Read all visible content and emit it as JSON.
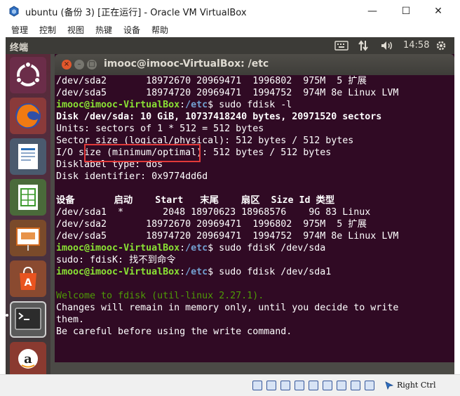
{
  "host": {
    "window_title": "ubuntu (备份 3) [正在运行] - Oracle VM VirtualBox",
    "menu": [
      "管理",
      "控制",
      "视图",
      "热键",
      "设备",
      "帮助"
    ],
    "controls": {
      "minimize": "—",
      "maximize": "☐",
      "close": "✕"
    },
    "host_key": "Right Ctrl"
  },
  "guest": {
    "panel_title": "终端",
    "clock": "14:58",
    "launcher_items": [
      "dash-home",
      "firefox",
      "libreoffice-writer",
      "libreoffice-calc",
      "libreoffice-impress",
      "ubuntu-software",
      "terminal",
      "amazon",
      "updater"
    ]
  },
  "terminal": {
    "title": "imooc@imooc-VirtualBox: /etc",
    "window_controls": {
      "close": "×",
      "minimize": "–",
      "maximize": "□"
    },
    "lines": [
      {
        "segments": [
          {
            "text": "/dev/sda2       18972670 20969471  1996802  975M  5 扩展",
            "style": "plain"
          }
        ]
      },
      {
        "segments": [
          {
            "text": "/dev/sda5       18974720 20969471  1994752  974M 8e Linux LVM",
            "style": "plain"
          }
        ]
      },
      {
        "segments": [
          {
            "text": "imooc@imooc-VirtualBox",
            "style": "prompt-user"
          },
          {
            "text": ":",
            "style": "plain"
          },
          {
            "text": "/etc",
            "style": "prompt-path"
          },
          {
            "text": "$ sudo fdisk -l",
            "style": "plain"
          }
        ]
      },
      {
        "segments": [
          {
            "text": "Disk /dev/sda: 10 GiB, 10737418240 bytes, 20971520 sectors",
            "style": "bold"
          }
        ]
      },
      {
        "segments": [
          {
            "text": "Units: sectors of 1 * 512 = 512 bytes",
            "style": "plain"
          }
        ]
      },
      {
        "segments": [
          {
            "text": "Sector size (logical/physical): 512 bytes / 512 bytes",
            "style": "plain"
          }
        ]
      },
      {
        "segments": [
          {
            "text": "I/O size (minimum/optimal): 512 bytes / 512 bytes",
            "style": "plain"
          }
        ]
      },
      {
        "segments": [
          {
            "text": "Disklabel type: dos",
            "style": "plain"
          }
        ]
      },
      {
        "segments": [
          {
            "text": "Disk identifier: 0x9774dd6d",
            "style": "plain"
          }
        ]
      },
      {
        "segments": [
          {
            "text": "",
            "style": "plain"
          }
        ]
      },
      {
        "segments": [
          {
            "text": "设备       启动    Start   末尾    扇区  Size Id 类型",
            "style": "bold"
          }
        ]
      },
      {
        "segments": [
          {
            "text": "/dev/sda1  *       2048 18970623 18968576    9G 83 Linux",
            "style": "plain"
          }
        ]
      },
      {
        "segments": [
          {
            "text": "/dev/sda2       18972670 20969471  1996802  975M  5 扩展",
            "style": "plain"
          }
        ]
      },
      {
        "segments": [
          {
            "text": "/dev/sda5       18974720 20969471  1994752  974M 8e Linux LVM",
            "style": "plain"
          }
        ]
      },
      {
        "segments": [
          {
            "text": "imooc@imooc-VirtualBox",
            "style": "prompt-user"
          },
          {
            "text": ":",
            "style": "plain"
          },
          {
            "text": "/etc",
            "style": "prompt-path"
          },
          {
            "text": "$ sudo fdisK /dev/sda",
            "style": "plain"
          }
        ]
      },
      {
        "segments": [
          {
            "text": "sudo: fdisK: 找不到命令",
            "style": "plain"
          }
        ]
      },
      {
        "segments": [
          {
            "text": "imooc@imooc-VirtualBox",
            "style": "prompt-user"
          },
          {
            "text": ":",
            "style": "plain"
          },
          {
            "text": "/etc",
            "style": "prompt-path"
          },
          {
            "text": "$ sudo fdisk /dev/sda1",
            "style": "plain"
          }
        ]
      },
      {
        "segments": [
          {
            "text": "",
            "style": "plain"
          }
        ]
      },
      {
        "segments": [
          {
            "text": "Welcome to fdisk (util-linux 2.27.1).",
            "style": "green"
          }
        ]
      },
      {
        "segments": [
          {
            "text": "Changes will remain in memory only, until you decide to write",
            "style": "plain"
          }
        ]
      },
      {
        "segments": [
          {
            "text": "them.",
            "style": "plain"
          }
        ]
      },
      {
        "segments": [
          {
            "text": "Be careful before using the write command.",
            "style": "plain"
          }
        ]
      }
    ]
  },
  "colors": {
    "terminal_bg": "#300a24",
    "prompt_user": "#8ae234",
    "prompt_path": "#729fcf",
    "welcome_text": "#4e9a06",
    "annotation_box": "#e23a3a",
    "ubuntu_panel": "#3c3b37"
  },
  "icons": {
    "vbox": "virtualbox-icon",
    "keyboard": "keyboard-icon",
    "network": "network-updown-icon",
    "volume": "volume-icon",
    "settings": "gear-icon"
  }
}
